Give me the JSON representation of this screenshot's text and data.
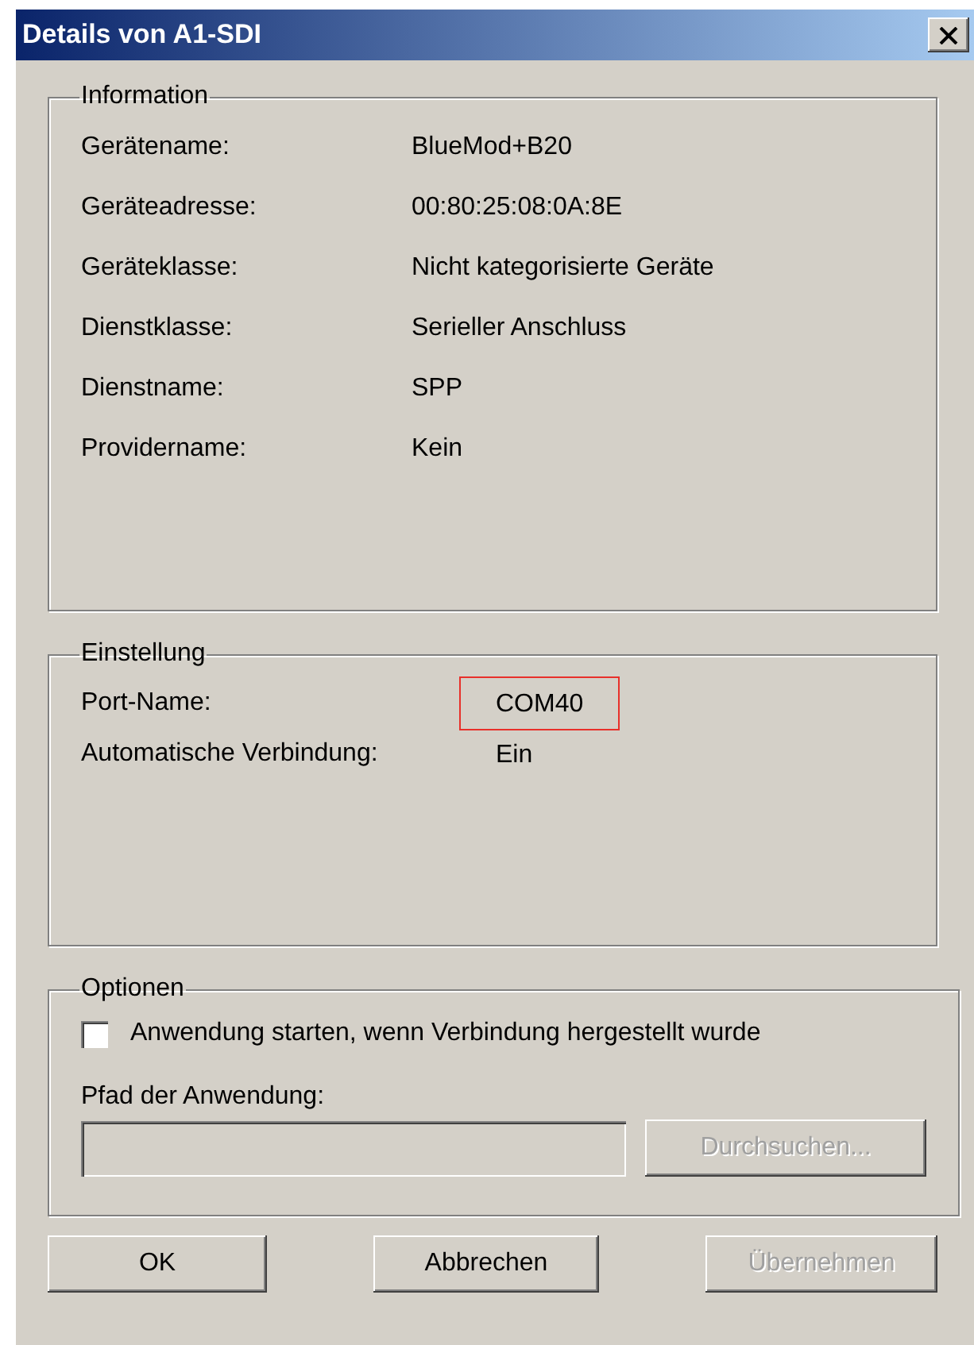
{
  "window": {
    "title": "Details von A1-SDI"
  },
  "information": {
    "title": "Information",
    "rows": [
      {
        "label": "Gerätename:",
        "value": "BlueMod+B20"
      },
      {
        "label": "Geräteadresse:",
        "value": "00:80:25:08:0A:8E"
      },
      {
        "label": "Geräteklasse:",
        "value": "Nicht kategorisierte Geräte"
      },
      {
        "label": "Dienstklasse:",
        "value": "Serieller Anschluss"
      },
      {
        "label": "Dienstname:",
        "value": "SPP"
      },
      {
        "label": "Providername:",
        "value": "Kein"
      }
    ]
  },
  "settings": {
    "title": "Einstellung",
    "rows": [
      {
        "label": "Port-Name:",
        "value": "COM40",
        "highlighted": true
      },
      {
        "label": "Automatische Verbindung:",
        "value": "Ein",
        "highlighted": false
      }
    ]
  },
  "options": {
    "title": "Optionen",
    "checkbox": {
      "label": "Anwendung starten, wenn Verbindung hergestellt wurde",
      "checked": false
    },
    "path_label": "Pfad der Anwendung:",
    "path_field": {
      "disabled": true
    },
    "browse_button": {
      "label": "Durchsuchen...",
      "disabled": true
    }
  },
  "buttons": [
    {
      "label": "OK",
      "disabled": false
    },
    {
      "label": "Abbrechen",
      "disabled": false
    },
    {
      "label": "Übernehmen",
      "disabled": true
    }
  ]
}
